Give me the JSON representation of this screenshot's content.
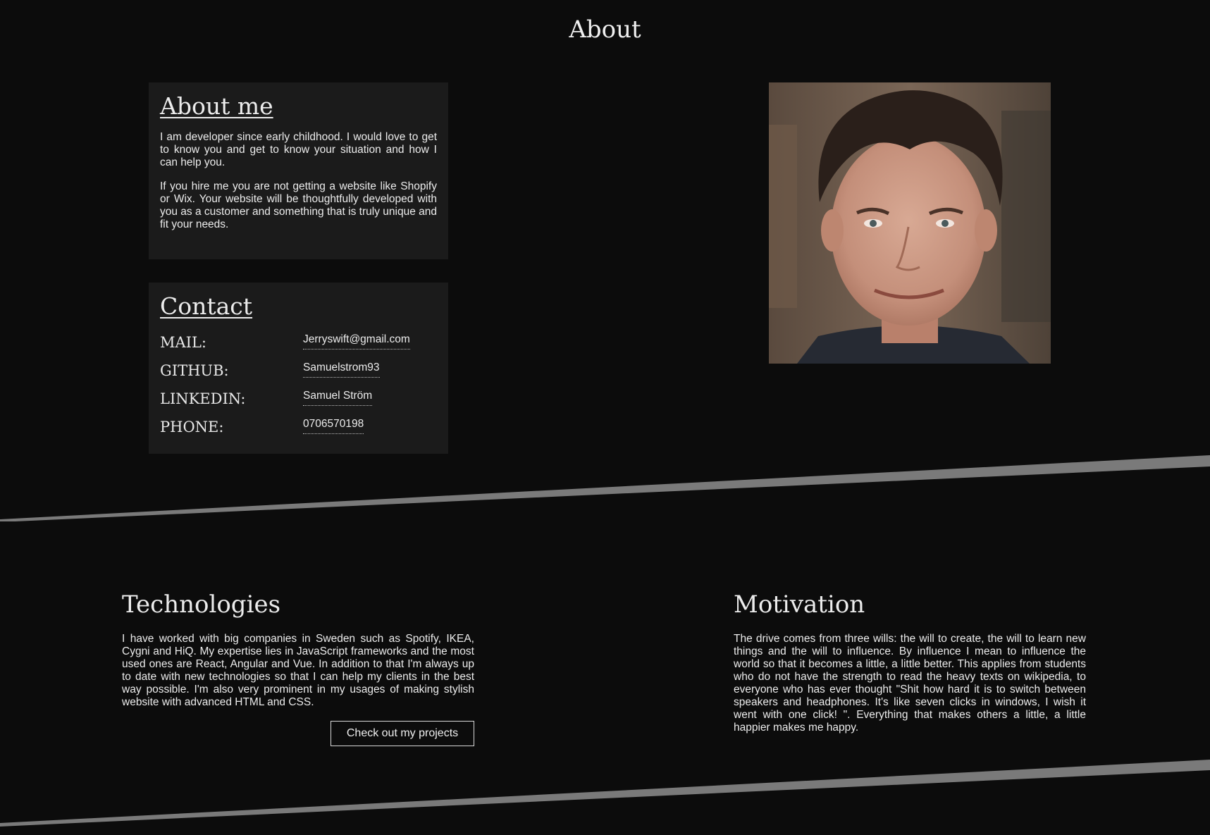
{
  "page": {
    "title": "About"
  },
  "about_card": {
    "heading": "About me",
    "paragraphs": [
      "I am developer since early childhood. I would love to get to know you and get to know your situation and how I can help you.",
      "If you hire me you are not getting a website like Shopify or Wix. Your website will be thoughtfully developed with you as a customer and something that is truly unique and fit your needs."
    ]
  },
  "contact_card": {
    "heading": "Contact",
    "rows": [
      {
        "label": "MAIL:",
        "value": "Jerryswift@gmail.com"
      },
      {
        "label": "GITHUB:",
        "value": "Samuelstrom93"
      },
      {
        "label": "LINKEDIN:",
        "value": "Samuel Ström"
      },
      {
        "label": "PHONE:",
        "value": "0706570198"
      }
    ]
  },
  "technologies": {
    "heading": "Technologies",
    "text": "I have worked with big companies in Sweden such as Spotify, IKEA, Cygni and HiQ. My expertise lies in JavaScript frameworks and the most used ones are React, Angular and Vue. In addition to that I'm always up to date with new technologies so that I can help my clients in the best way possible. I'm also very prominent in my usages of making stylish website with advanced HTML and CSS.",
    "button_label": "Check out my projects"
  },
  "motivation": {
    "heading": "Motivation",
    "text": "The drive comes from three wills: the will to create, the will to learn new things and the will to influence. By influence I mean to influence the world so that it becomes a little, a little better. This applies from students who do not have the strength to read the heavy texts on wikipedia, to everyone who has ever thought \"Shit how hard it is to switch between speakers and headphones. It's like seven clicks in windows, I wish it went with one click! \". Everything that makes others a little, a little happier makes me happy."
  },
  "colors": {
    "background": "#0c0c0c",
    "card": "#1b1b1b",
    "divider": "#7a7a7a",
    "text": "#ececec"
  }
}
